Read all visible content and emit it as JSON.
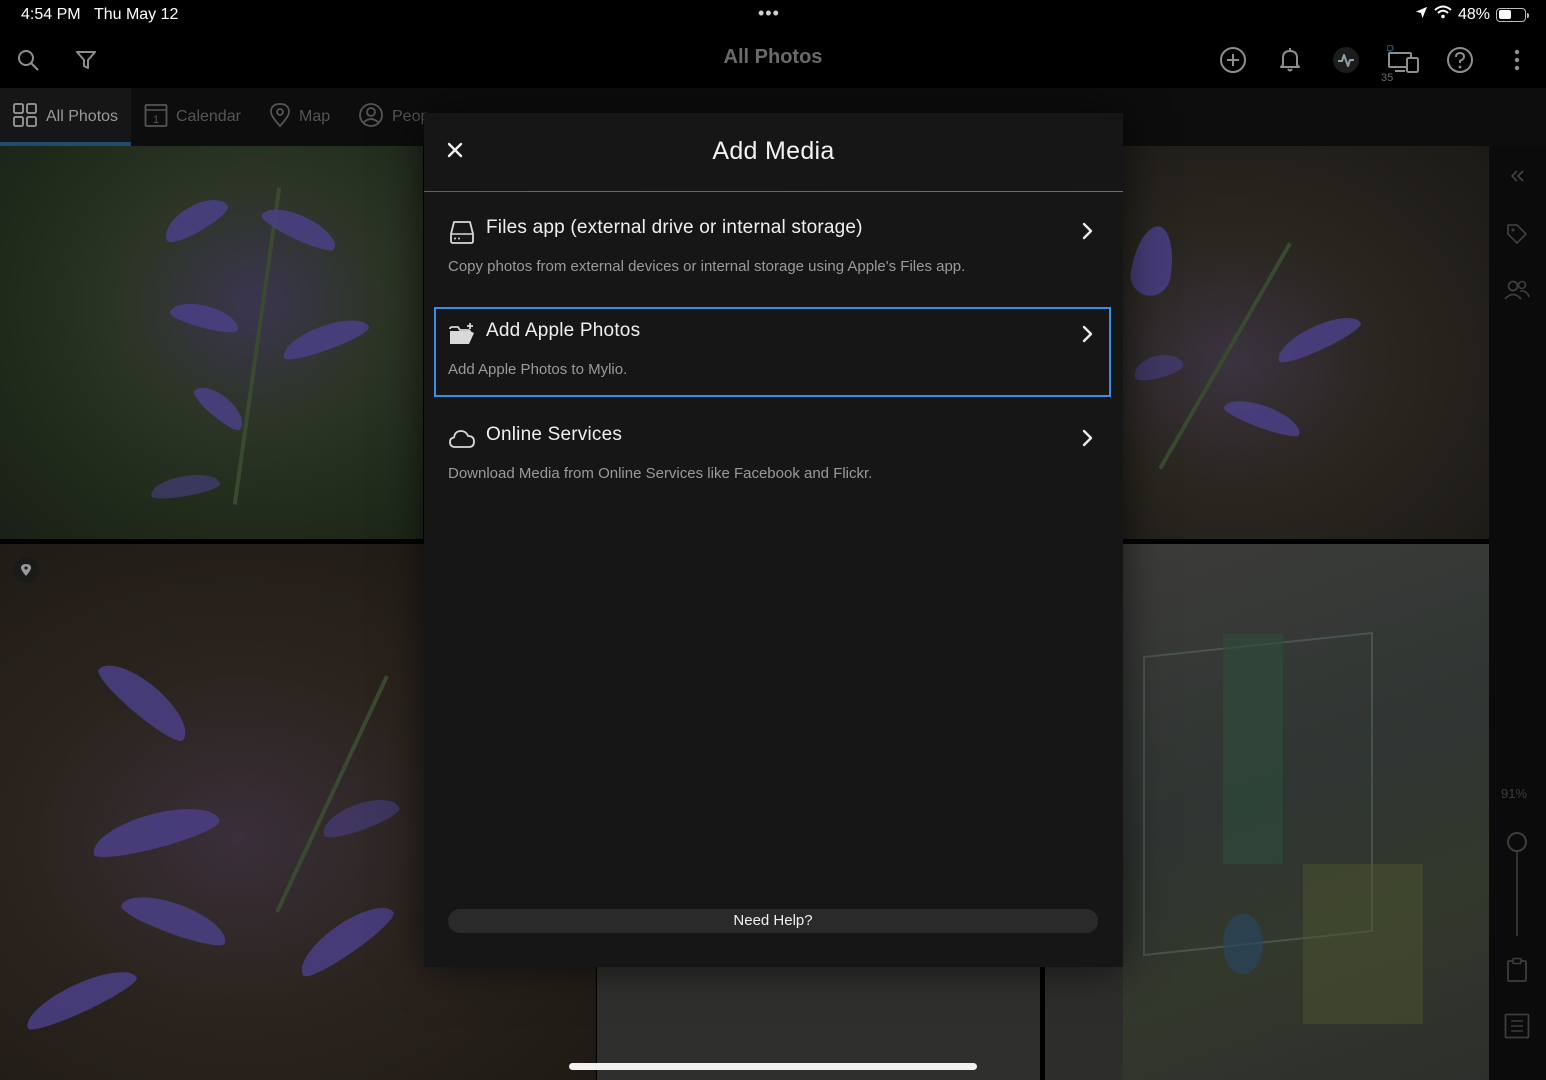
{
  "status_bar": {
    "time": "4:54 PM",
    "date": "Thu May 12",
    "multitask_dots": "•••",
    "battery_percent": "48%",
    "battery_level": 0.48,
    "icons": [
      "location-arrow-icon",
      "wifi-icon",
      "battery-icon"
    ]
  },
  "toolbar": {
    "title": "All Photos",
    "device_badge_count": "35",
    "icons": [
      "search-icon",
      "filter-icon",
      "add-circle-icon",
      "bell-icon",
      "activity-icon",
      "devices-icon",
      "help-icon",
      "more-vertical-icon"
    ]
  },
  "tabs": [
    {
      "label": "All Photos",
      "icon": "grid-icon",
      "active": true
    },
    {
      "label": "Calendar",
      "icon": "calendar-icon",
      "active": false
    },
    {
      "label": "Map",
      "icon": "map-pin-icon",
      "active": false
    },
    {
      "label": "Peop",
      "icon": "person-icon",
      "active": false
    }
  ],
  "right_rail": {
    "zoom_label": "91%",
    "icons": [
      "collapse-left-icon",
      "tag-icon",
      "people-icon",
      "clipboard-icon",
      "list-icon"
    ]
  },
  "modal": {
    "title": "Add Media",
    "options": [
      {
        "title": "Files app (external drive or internal storage)",
        "description": "Copy photos from external devices or internal storage using Apple's Files app.",
        "icon": "hard-drive-icon",
        "selected": false
      },
      {
        "title": "Add Apple Photos",
        "description": "Add Apple Photos to Mylio.",
        "icon": "folder-add-icon",
        "selected": true
      },
      {
        "title": "Online Services",
        "description": "Download Media from Online Services like Facebook and Flickr.",
        "icon": "cloud-icon",
        "selected": false
      }
    ],
    "help_label": "Need Help?"
  },
  "colors": {
    "accent_blue": "#3a8ee6",
    "modal_bg": "#161616",
    "tab_underline": "#1e4c6e"
  }
}
